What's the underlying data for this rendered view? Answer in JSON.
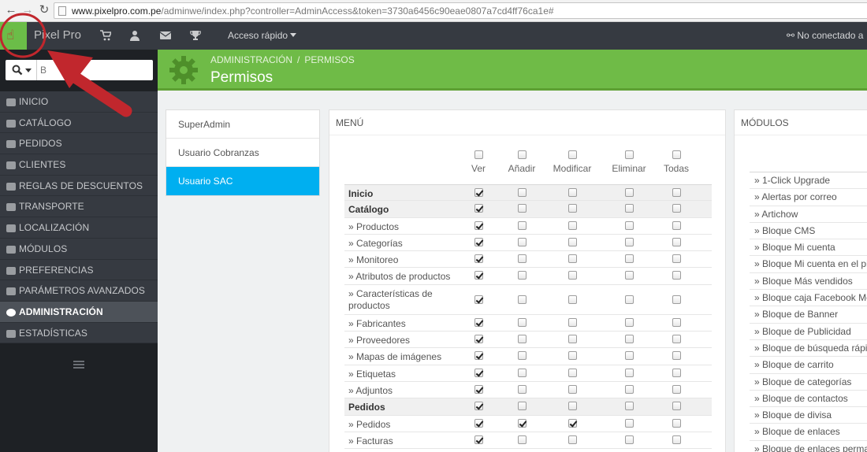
{
  "browser": {
    "url_host": "www.pixelpro.com.pe",
    "url_path": "/adminwe/index.php?controller=AdminAccess&token=3730a6456c90eae0807a7cd4ff76ca1e#"
  },
  "header": {
    "brand": "Pixel Pro",
    "quick_access": "Acceso rápido",
    "status": "No conectado a"
  },
  "sidebar": {
    "search_placeholder": "B",
    "items": [
      {
        "label": "Inicio"
      },
      {
        "label": "Catálogo"
      },
      {
        "label": "Pedidos"
      },
      {
        "label": "Clientes"
      },
      {
        "label": "Reglas de descuentos"
      },
      {
        "label": "Transporte"
      },
      {
        "label": "Localización"
      },
      {
        "label": "Módulos"
      },
      {
        "label": "Preferencias"
      },
      {
        "label": "Parámetros avanzados"
      },
      {
        "label": "Administración",
        "active": true
      },
      {
        "label": "Estadísticas"
      }
    ]
  },
  "page": {
    "breadcrumb": [
      "Administración",
      "Permisos"
    ],
    "breadcrumb_sep": "/",
    "title": "Permisos"
  },
  "profiles": [
    {
      "label": "SuperAdmin"
    },
    {
      "label": "Usuario Cobranzas"
    },
    {
      "label": "Usuario SAC",
      "active": true
    }
  ],
  "menu_panel": {
    "title": "Menú",
    "columns": [
      "Ver",
      "Añadir",
      "Modificar",
      "Eliminar",
      "Todas"
    ],
    "rows": [
      {
        "label": "Inicio",
        "group": true,
        "perms": [
          true,
          false,
          false,
          false,
          false
        ]
      },
      {
        "label": "Catálogo",
        "group": true,
        "perms": [
          true,
          false,
          false,
          false,
          false
        ]
      },
      {
        "label": "» Productos",
        "perms": [
          true,
          false,
          false,
          false,
          false
        ]
      },
      {
        "label": "» Categorías",
        "perms": [
          true,
          false,
          false,
          false,
          false
        ]
      },
      {
        "label": "» Monitoreo",
        "perms": [
          true,
          false,
          false,
          false,
          false
        ]
      },
      {
        "label": "» Atributos de productos",
        "perms": [
          true,
          false,
          false,
          false,
          false
        ]
      },
      {
        "label": "» Características de productos",
        "tall": true,
        "perms": [
          true,
          false,
          false,
          false,
          false
        ]
      },
      {
        "label": "» Fabricantes",
        "perms": [
          true,
          false,
          false,
          false,
          false
        ]
      },
      {
        "label": "» Proveedores",
        "perms": [
          true,
          false,
          false,
          false,
          false
        ]
      },
      {
        "label": "» Mapas de imágenes",
        "perms": [
          true,
          false,
          false,
          false,
          false
        ]
      },
      {
        "label": "» Etiquetas",
        "perms": [
          true,
          false,
          false,
          false,
          false
        ]
      },
      {
        "label": "» Adjuntos",
        "perms": [
          true,
          false,
          false,
          false,
          false
        ]
      },
      {
        "label": "Pedidos",
        "group": true,
        "perms": [
          true,
          false,
          false,
          false,
          false
        ]
      },
      {
        "label": "» Pedidos",
        "perms": [
          true,
          true,
          true,
          false,
          false
        ]
      },
      {
        "label": "» Facturas",
        "perms": [
          true,
          false,
          false,
          false,
          false
        ]
      }
    ]
  },
  "modules_panel": {
    "title": "Módulos",
    "items": [
      "» 1-Click Upgrade",
      "» Alertas por correo",
      "» Artichow",
      "» Bloque CMS",
      "» Bloque Mi cuenta",
      "» Bloque Mi cuenta en el pi",
      "» Bloque Más vendidos",
      "» Bloque caja Facebook Me",
      "» Bloque de Banner",
      "» Bloque de Publicidad",
      "» Bloque de búsqueda rápi",
      "» Bloque de carrito",
      "» Bloque de categorías",
      "» Bloque de contactos",
      "» Bloque de divisa",
      "» Bloque de enlaces",
      "» Bloque de enlaces perma"
    ]
  },
  "colors": {
    "accent_green": "#6fbb47",
    "sidebar_dark": "#363a41",
    "active_profile": "#00aff0",
    "annotation_red": "#c1272d"
  }
}
